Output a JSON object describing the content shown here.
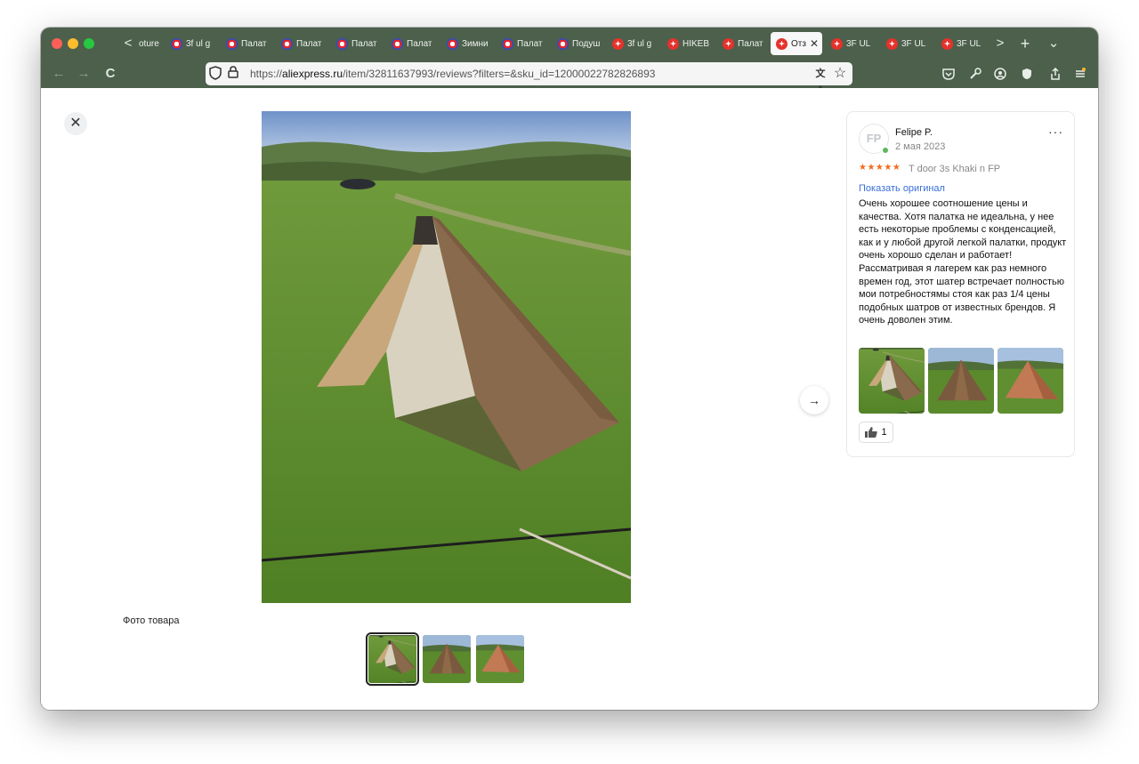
{
  "browser": {
    "tabs": [
      {
        "label": "oture",
        "icon": "none"
      },
      {
        "label": "3f ul g",
        "icon": "blue"
      },
      {
        "label": "Палат",
        "icon": "blue"
      },
      {
        "label": "Палат",
        "icon": "blue"
      },
      {
        "label": "Палат",
        "icon": "blue"
      },
      {
        "label": "Палат",
        "icon": "blue"
      },
      {
        "label": "Зимни",
        "icon": "blue"
      },
      {
        "label": "Палат",
        "icon": "blue"
      },
      {
        "label": "Подуш",
        "icon": "blue"
      },
      {
        "label": "3f ul g",
        "icon": "red"
      },
      {
        "label": "HIKEB",
        "icon": "red"
      },
      {
        "label": "Палат",
        "icon": "red"
      },
      {
        "label": "Отз",
        "icon": "red",
        "active": true
      },
      {
        "label": "3F UL",
        "icon": "red"
      },
      {
        "label": "3F UL",
        "icon": "red"
      },
      {
        "label": "3F UL",
        "icon": "red"
      }
    ],
    "url": {
      "prefix": "https://",
      "domain": "aliexpress.ru",
      "path": "/item/32811637993/reviews?filters=&sku_id=12000022782826893"
    },
    "icons": {
      "back": "←",
      "forward": "→",
      "reload": "C",
      "new_tab": "+",
      "tab_list": "⌄",
      "scroll_left": "<",
      "scroll_right": ">",
      "shield": "shield-icon",
      "lock": "lock-icon",
      "translate": "文A",
      "bookmark": "☆"
    }
  },
  "gallery": {
    "close": "✕",
    "photo_label": "Фото товара",
    "next": "→",
    "thumbnails": 3,
    "selected_thumbnail": 0
  },
  "review": {
    "avatar_initials": "FP",
    "author": "Felipe P.",
    "date": "2 мая 2023",
    "more": "···",
    "stars": "★★★★★",
    "rating": 5,
    "variant": "T door 3s Khaki n FP",
    "show_original": "Показать оригинал",
    "text": "Очень хорошее соотношение цены и качества. Хотя палатка не идеальна, у нее есть некоторые проблемы с конденсацией, как и у любой другой легкой палатки, продукт очень хорошо сделан и работает! Рассматривая я лагерем как раз немного времен год, этот шатер встречает полностью мои потребностямы стоя как раз 1/4 цены подобных шатров от известных брендов. Я очень доволен этим.",
    "likes": "1"
  },
  "colors": {
    "browser_chrome": "#4c604c",
    "accent_orange": "#f26b1d",
    "link_blue": "#3a6fd8"
  }
}
